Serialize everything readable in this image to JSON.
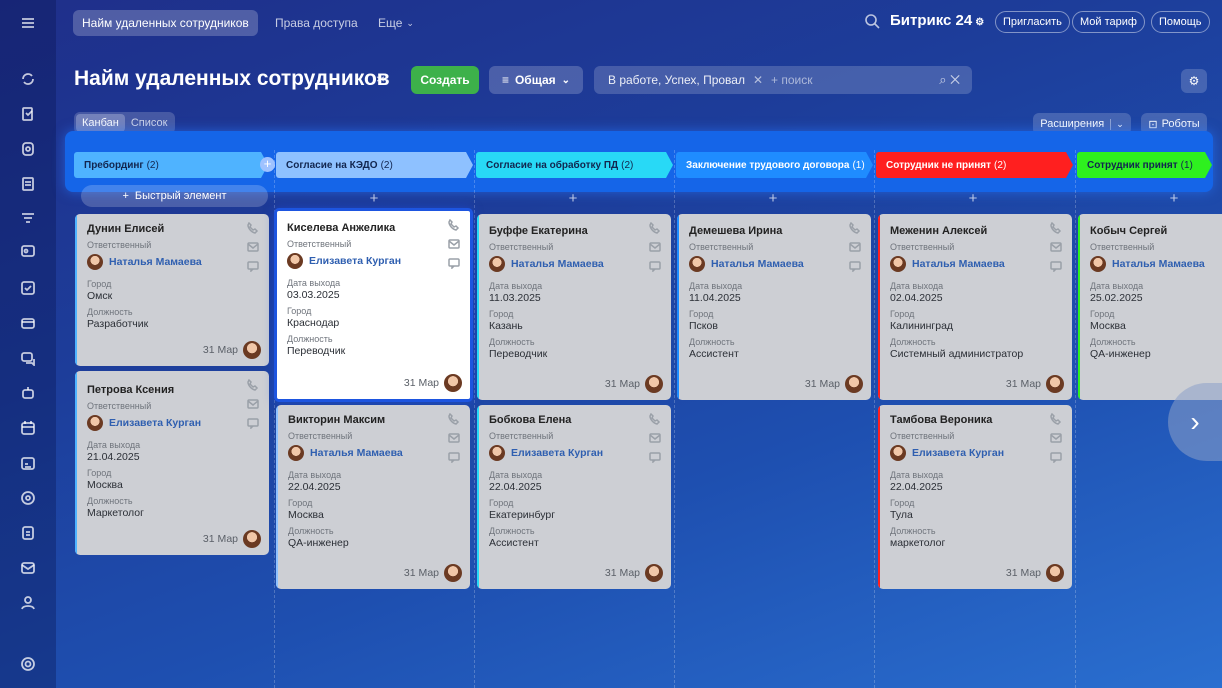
{
  "topbar": {
    "tabs": [
      "Найм удаленных сотрудников",
      "Права доступа",
      "Еще"
    ],
    "brand": "Битрикс 24",
    "invite": "Пригласить",
    "tariff": "Мой тариф",
    "help": "Помощь"
  },
  "header": {
    "title": "Найм удаленных сотрудников",
    "create": "Создать",
    "filter_label": "Общая",
    "search_chip": "В работе, Успех, Провал",
    "search_placeholder": "+ поиск"
  },
  "views": {
    "kanban": "Канбан",
    "list": "Список",
    "extensions": "Расширения",
    "robots": "Роботы"
  },
  "quick_add": "Быстрый элемент",
  "stages": [
    {
      "name": "Пребординг",
      "count": "(2)",
      "color": "#4fb3ff"
    },
    {
      "name": "Согласие на КЭДО",
      "count": "(2)",
      "color": "#8ec1ff"
    },
    {
      "name": "Согласие на обработку ПД",
      "count": "(2)",
      "color": "#28d9f6"
    },
    {
      "name": "Заключение трудового договора",
      "count": "(1)",
      "color": "#1f8cff"
    },
    {
      "name": "Сотрудник не принят",
      "count": "(2)",
      "color": "#ff1f1f"
    },
    {
      "name": "Сотрудник принят",
      "count": "(1)",
      "color": "#2ef01f"
    }
  ],
  "labels": {
    "responsible": "Ответственный",
    "exit_date": "Дата выхода",
    "city": "Город",
    "position": "Должность"
  },
  "cards": [
    {
      "name": "Дунин Елисей",
      "user": "Наталья Мамаева",
      "city": "Омск",
      "position": "Разработчик",
      "date": "31 Мар"
    },
    {
      "name": "Петрова Ксения",
      "user": "Елизавета Курган",
      "exit": "21.04.2025",
      "city": "Москва",
      "position": "Маркетолог",
      "date": "31 Мар"
    },
    {
      "name": "Киселева Анжелика",
      "user": "Елизавета Курган",
      "exit": "03.03.2025",
      "city": "Краснодар",
      "position": "Переводчик",
      "date": "31 Мар"
    },
    {
      "name": "Викторин Максим",
      "user": "Наталья Мамаева",
      "exit": "22.04.2025",
      "city": "Москва",
      "position": "QA-инженер",
      "date": "31 Мар"
    },
    {
      "name": "Буффе Екатерина",
      "user": "Наталья Мамаева",
      "exit": "11.03.2025",
      "city": "Казань",
      "position": "Переводчик",
      "date": "31 Мар"
    },
    {
      "name": "Бобкова Елена",
      "user": "Елизавета Курган",
      "exit": "22.04.2025",
      "city": "Екатеринбург",
      "position": "Ассистент",
      "date": "31 Мар"
    },
    {
      "name": "Демешева Ирина",
      "user": "Наталья Мамаева",
      "exit": "11.04.2025",
      "city": "Псков",
      "position": "Ассистент",
      "date": "31 Мар"
    },
    {
      "name": "Меженин Алексей",
      "user": "Наталья Мамаева",
      "exit": "02.04.2025",
      "city": "Калининград",
      "position": "Системный администратор",
      "date": "31 Мар"
    },
    {
      "name": "Тамбова Вероника",
      "user": "Елизавета Курган",
      "exit": "22.04.2025",
      "city": "Тула",
      "position": "маркетолог",
      "date": "31 Мар"
    },
    {
      "name": "Кобыч Сергей",
      "user": "Наталья Мамаева",
      "exit": "25.02.2025",
      "city": "Москва",
      "position": "QA-инженер"
    }
  ]
}
